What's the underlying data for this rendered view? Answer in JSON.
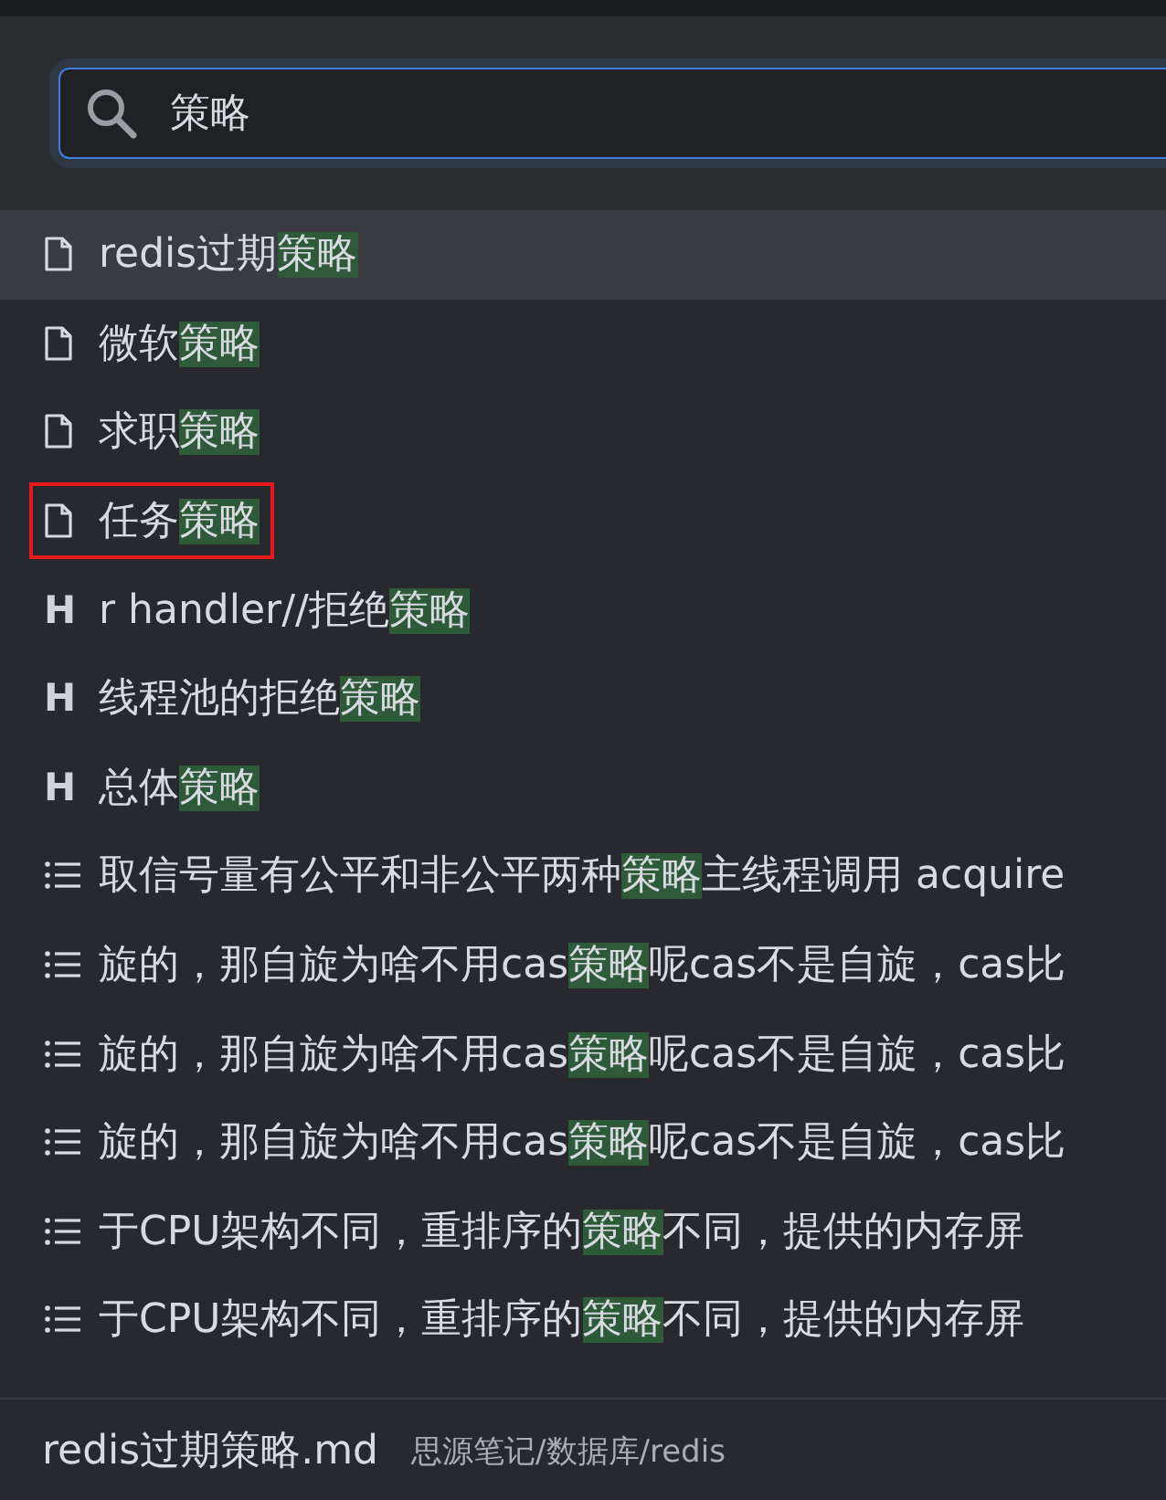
{
  "search": {
    "value": "策略"
  },
  "results": [
    {
      "kind": "doc",
      "before": "redis过期",
      "match": "策略",
      "selected": true,
      "outlined": false
    },
    {
      "kind": "doc",
      "before": "微软",
      "match": "策略",
      "selected": false,
      "outlined": false
    },
    {
      "kind": "doc",
      "before": "求职",
      "match": "策略",
      "selected": false,
      "outlined": false
    },
    {
      "kind": "doc",
      "before": "任务",
      "match": "策略",
      "selected": false,
      "outlined": true
    },
    {
      "kind": "heading",
      "marker": "H",
      "before": "r handler//拒绝",
      "match": "策略",
      "selected": false,
      "outlined": false
    },
    {
      "kind": "heading",
      "marker": "H",
      "before": "线程池的拒绝",
      "match": "策略",
      "selected": false,
      "outlined": false
    },
    {
      "kind": "heading",
      "marker": "H",
      "before": "总体",
      "match": "策略",
      "selected": false,
      "outlined": false
    },
    {
      "kind": "list",
      "before": "取信号量有公平和非公平两种",
      "match": "策略",
      "after": "主线程调用 acquire",
      "selected": false,
      "outlined": false
    },
    {
      "kind": "list",
      "before": "旋的，那自旋为啥不用cas",
      "match": "策略",
      "after": "呢cas不是自旋，cas比",
      "selected": false,
      "outlined": false
    },
    {
      "kind": "list",
      "before": "旋的，那自旋为啥不用cas",
      "match": "策略",
      "after": "呢cas不是自旋，cas比",
      "selected": false,
      "outlined": false
    },
    {
      "kind": "list",
      "before": "旋的，那自旋为啥不用cas",
      "match": "策略",
      "after": "呢cas不是自旋，cas比",
      "selected": false,
      "outlined": false
    },
    {
      "kind": "list",
      "before": "于CPU架构不同，重排序的",
      "match": "策略",
      "after": "不同，提供的内存屏",
      "selected": false,
      "outlined": false
    },
    {
      "kind": "list",
      "before": "于CPU架构不同，重排序的",
      "match": "策略",
      "after": "不同，提供的内存屏",
      "selected": false,
      "outlined": false
    }
  ],
  "footer": {
    "file": "redis过期策略.md",
    "path": "思源笔记/数据库/redis"
  }
}
